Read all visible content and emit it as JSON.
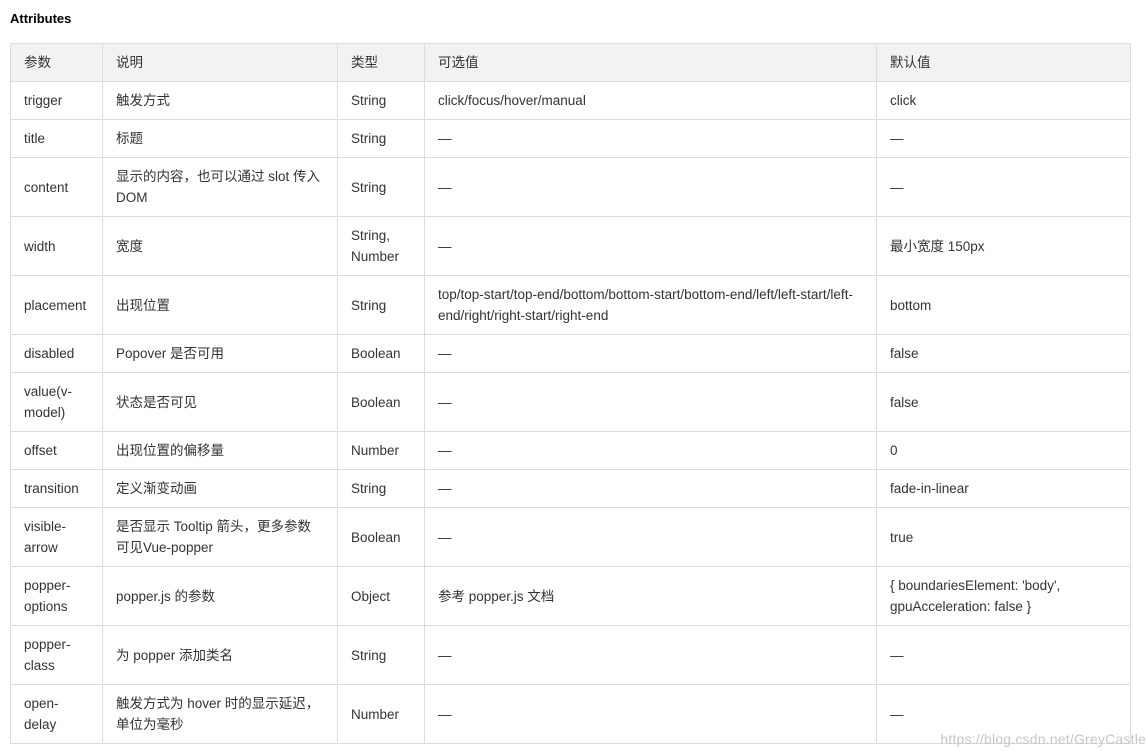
{
  "heading": "Attributes",
  "table": {
    "headers": [
      "参数",
      "说明",
      "类型",
      "可选值",
      "默认值"
    ],
    "rows": [
      [
        "trigger",
        "触发方式",
        "String",
        "click/focus/hover/manual",
        "click"
      ],
      [
        "title",
        "标题",
        "String",
        "—",
        "—"
      ],
      [
        "content",
        "显示的内容，也可以通过 slot 传入 DOM",
        "String",
        "—",
        "—"
      ],
      [
        "width",
        "宽度",
        "String, Number",
        "—",
        "最小宽度 150px"
      ],
      [
        "placement",
        "出现位置",
        "String",
        "top/top-start/top-end/bottom/bottom-start/bottom-end/left/left-start/left-end/right/right-start/right-end",
        "bottom"
      ],
      [
        "disabled",
        "Popover 是否可用",
        "Boolean",
        "—",
        "false"
      ],
      [
        "value(v-model)",
        "状态是否可见",
        "Boolean",
        "—",
        "false"
      ],
      [
        "offset",
        "出现位置的偏移量",
        "Number",
        "—",
        "0"
      ],
      [
        "transition",
        "定义渐变动画",
        "String",
        "—",
        "fade-in-linear"
      ],
      [
        "visible-arrow",
        "是否显示 Tooltip 箭头，更多参数可见Vue-popper",
        "Boolean",
        "—",
        "true"
      ],
      [
        "popper-options",
        "popper.js 的参数",
        "Object",
        "参考 popper.js 文档",
        "{ boundariesElement: 'body', gpuAcceleration: false }"
      ],
      [
        "popper-class",
        "为 popper 添加类名",
        "String",
        "—",
        "—"
      ],
      [
        "open-delay",
        "触发方式为 hover 时的显示延迟，单位为毫秒",
        "Number",
        "—",
        "—"
      ]
    ]
  },
  "watermark": "https://blog.csdn.net/GreyCastle"
}
